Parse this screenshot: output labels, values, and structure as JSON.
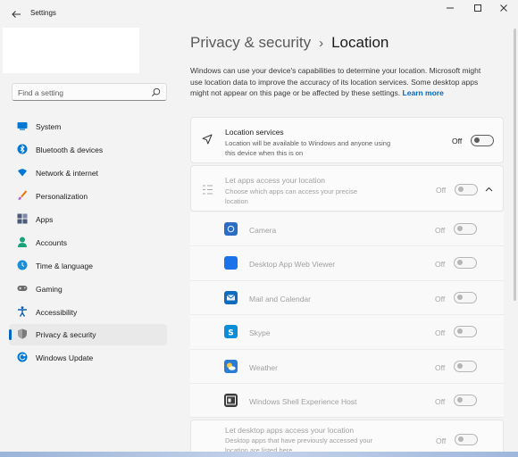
{
  "window": {
    "app_title": "Settings",
    "back_icon": "arrow-left-icon",
    "controls": [
      "minimize-icon",
      "maximize-icon",
      "close-icon"
    ]
  },
  "sidebar": {
    "search": {
      "placeholder": "Find a setting",
      "icon": "search-icon"
    },
    "items": [
      {
        "label": "System",
        "icon": "monitor-icon",
        "color": "#0078d4"
      },
      {
        "label": "Bluetooth & devices",
        "icon": "bluetooth-icon",
        "color": "#0078d4"
      },
      {
        "label": "Network & internet",
        "icon": "wifi-icon",
        "color": "#0078d4"
      },
      {
        "label": "Personalization",
        "icon": "brush-icon",
        "color": "#e8710a"
      },
      {
        "label": "Apps",
        "icon": "apps-icon",
        "color": "#4a5a78"
      },
      {
        "label": "Accounts",
        "icon": "person-icon",
        "color": "#1aa37a"
      },
      {
        "label": "Time & language",
        "icon": "globe-clock-icon",
        "color": "#1a8fd6"
      },
      {
        "label": "Gaming",
        "icon": "gamepad-icon",
        "color": "#6b6b6b"
      },
      {
        "label": "Accessibility",
        "icon": "accessibility-icon",
        "color": "#0a5fb4"
      },
      {
        "label": "Privacy & security",
        "icon": "shield-icon",
        "color": "#6b6b6b",
        "active": true
      },
      {
        "label": "Windows Update",
        "icon": "update-icon",
        "color": "#0078d4"
      }
    ]
  },
  "main": {
    "breadcrumb": {
      "parent": "Privacy & security",
      "separator": "›",
      "current": "Location"
    },
    "description": "Windows can use your device's capabilities to determine your location. Microsoft might use location data to improve the accuracy of its location services. Some desktop apps might not appear on this page or be affected by these settings.",
    "learn_more": "Learn more",
    "location_services": {
      "title": "Location services",
      "subtitle": "Location will be available to Windows and anyone using this device when this is on",
      "state": "Off",
      "icon": "location-arrow-icon"
    },
    "let_apps": {
      "title": "Let apps access your location",
      "subtitle": "Choose which apps can access your precise location",
      "state": "Off",
      "icon": "list-settings-icon",
      "chevron": "chevron-up-icon"
    },
    "apps": [
      {
        "name": "Camera",
        "state": "Off",
        "icon": "camera-app-icon",
        "color": "#2b6cc4"
      },
      {
        "name": "Desktop App Web Viewer",
        "state": "Off",
        "icon": "webview-app-icon",
        "color": "#1a73e8"
      },
      {
        "name": "Mail and Calendar",
        "state": "Off",
        "icon": "mail-app-icon",
        "color": "#0f6cbd"
      },
      {
        "name": "Skype",
        "state": "Off",
        "icon": "skype-app-icon",
        "color": "#0a8ed8"
      },
      {
        "name": "Weather",
        "state": "Off",
        "icon": "weather-app-icon",
        "color": "#2b7cd3"
      },
      {
        "name": "Windows Shell Experience Host",
        "state": "Off",
        "icon": "shell-host-app-icon",
        "color": "#3c3c3c"
      }
    ],
    "desktop_apps": {
      "title": "Let desktop apps access your location",
      "subtitle": "Desktop apps that have previously accessed your location are listed here",
      "state": "Off"
    }
  }
}
